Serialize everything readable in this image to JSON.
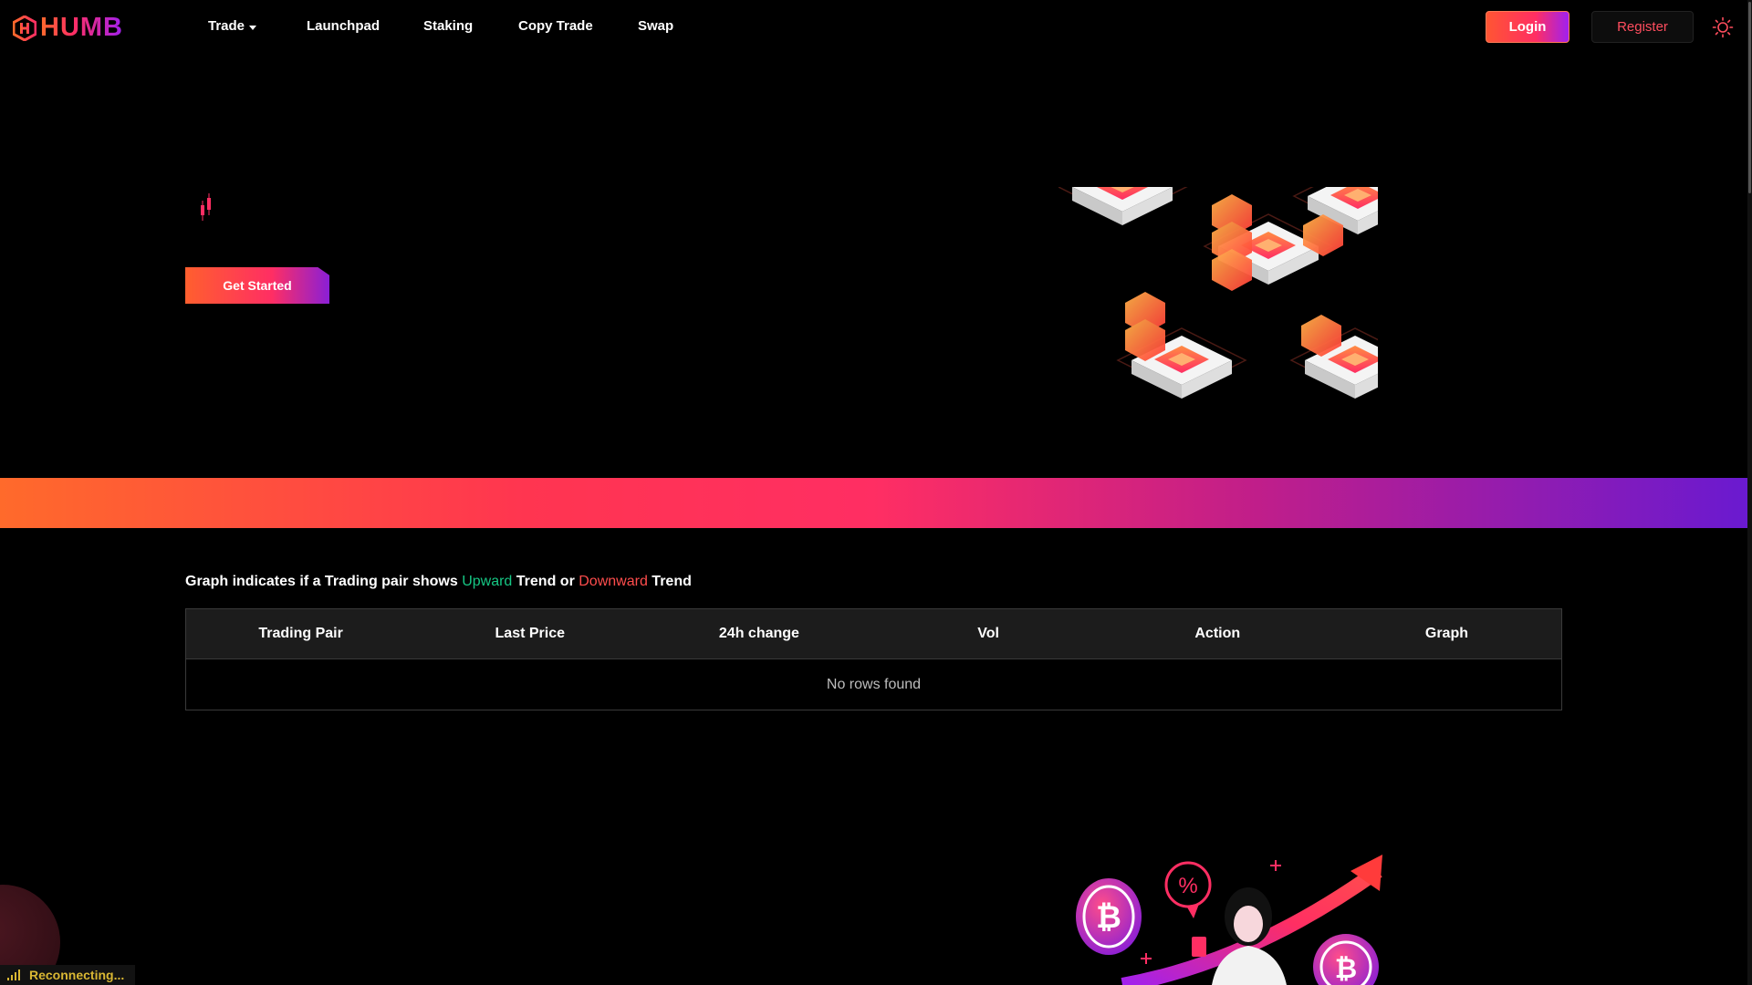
{
  "brand": {
    "logo_text": "HUMB"
  },
  "nav": {
    "items": [
      {
        "label": "Trade"
      },
      {
        "label": "Launchpad"
      },
      {
        "label": "Staking"
      },
      {
        "label": "Copy Trade"
      },
      {
        "label": "Swap"
      }
    ]
  },
  "auth": {
    "login_label": "Login",
    "register_label": "Register"
  },
  "hero": {
    "cta_label": "Get Started"
  },
  "market": {
    "legend": {
      "prefix": "Graph indicates if a Trading pair shows",
      "upward": "Upward",
      "trend1": "Trend or",
      "downward": "Downward",
      "trend2": "Trend"
    },
    "columns": [
      "Trading Pair",
      "Last Price",
      "24h change",
      "Vol",
      "Action",
      "Graph"
    ],
    "empty_message": "No rows found"
  },
  "status": {
    "connection": "Reconnecting..."
  },
  "colors": {
    "accent_orange": "#ff5f2e",
    "accent_pink": "#ff2e63",
    "accent_purple": "#8a1fd6",
    "up": "#16c784",
    "down": "#ff4d4d",
    "status_text": "#d9b733"
  }
}
